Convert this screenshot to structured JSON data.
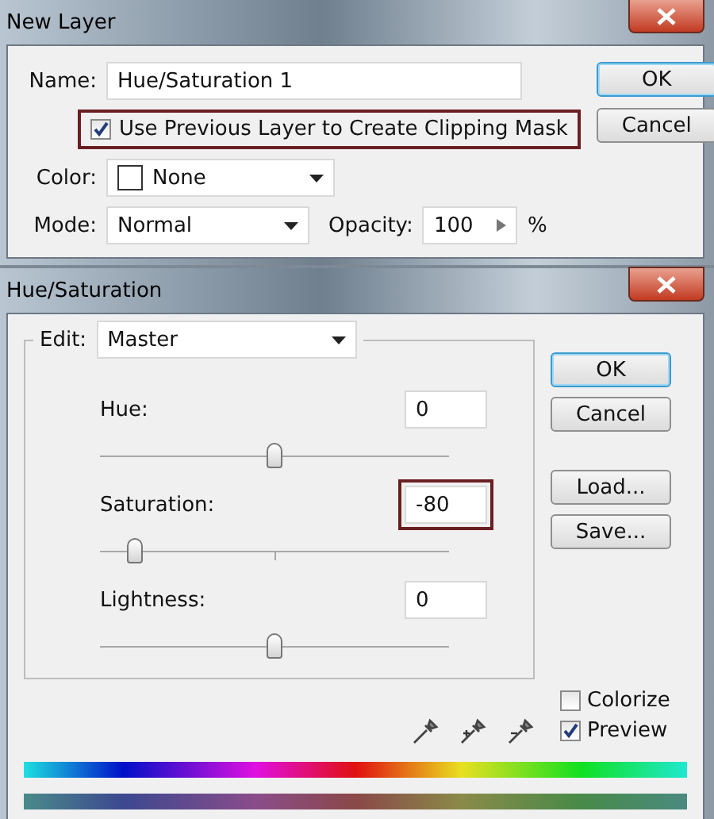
{
  "new_layer": {
    "title": "New Layer",
    "name_label": "Name:",
    "name_value": "Hue/Saturation 1",
    "clipping": {
      "label": "Use Previous Layer to Create Clipping Mask",
      "checked": true,
      "highlighted": true
    },
    "color_label": "Color:",
    "color_value": "None",
    "mode_label": "Mode:",
    "mode_value": "Normal",
    "opacity_label": "Opacity:",
    "opacity_value": "100",
    "opacity_unit": "%",
    "buttons": [
      {
        "label": "OK",
        "default": true
      },
      {
        "label": "Cancel",
        "default": false
      }
    ]
  },
  "hue_saturation": {
    "title": "Hue/Saturation",
    "edit_label": "Edit:",
    "edit_value": "Master",
    "sliders": [
      {
        "label": "Hue:",
        "value": "0",
        "level": 0.5,
        "highlighted": false
      },
      {
        "label": "Saturation:",
        "value": "-80",
        "level": 0.1,
        "highlighted": true
      },
      {
        "label": "Lightness:",
        "value": "0",
        "level": 0.5,
        "highlighted": false
      }
    ],
    "buttons": [
      {
        "label": "OK",
        "default": true
      },
      {
        "label": "Cancel",
        "default": false
      },
      {
        "label": "Load...",
        "default": false
      },
      {
        "label": "Save...",
        "default": false
      }
    ],
    "options": [
      {
        "label": "Colorize",
        "checked": false
      },
      {
        "label": "Preview",
        "checked": true
      }
    ]
  }
}
